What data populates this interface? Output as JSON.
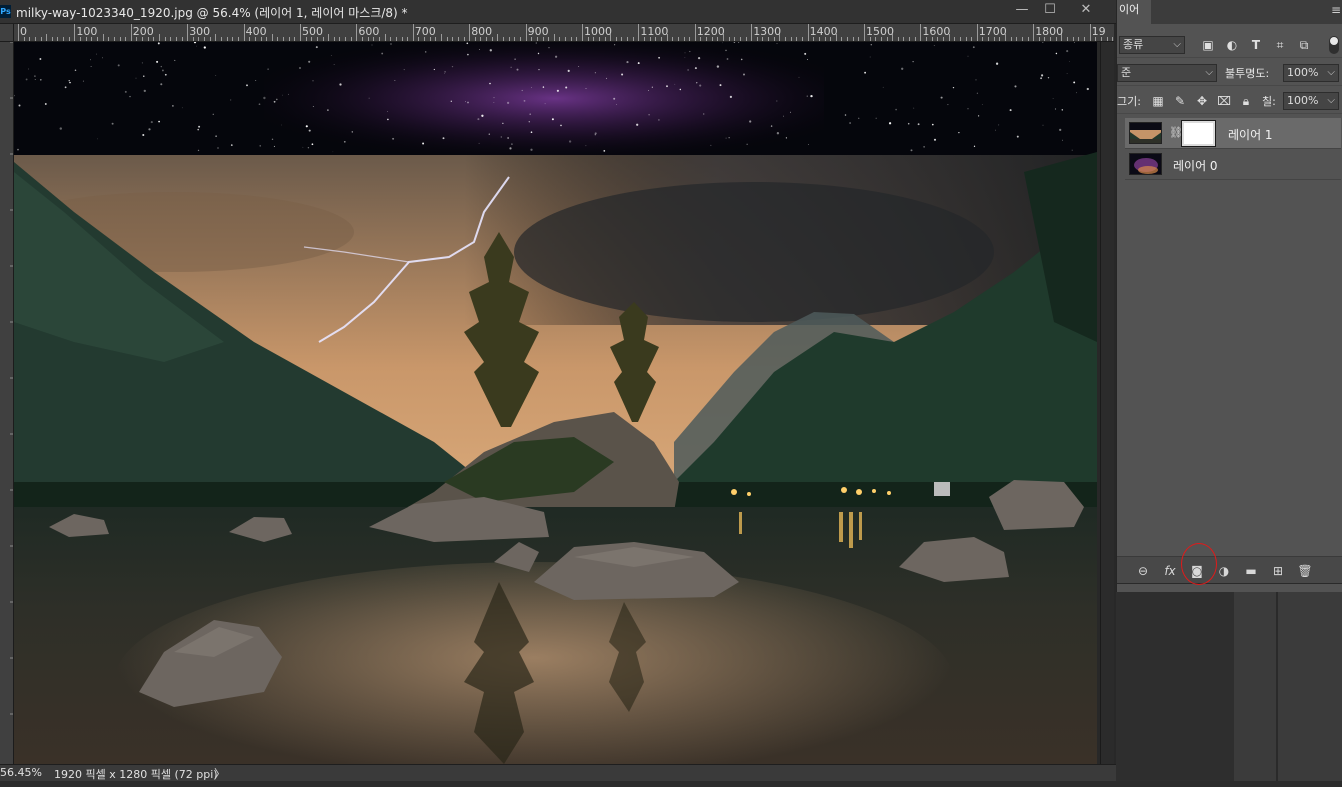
{
  "window": {
    "app_badge": "Ps",
    "title": "milky-way-1023340_1920.jpg @ 56.4% (레이어 1, 레이어 마스크/8) *",
    "controls": {
      "minimize": "—",
      "restore": "☐",
      "close": "✕"
    }
  },
  "ruler": {
    "labels": [
      "0",
      "100",
      "200",
      "300",
      "400",
      "500",
      "600",
      "700",
      "800",
      "900",
      "1000",
      "1100",
      "1200",
      "1300",
      "1400",
      "1500",
      "1600",
      "1700",
      "1800",
      "19"
    ]
  },
  "status": {
    "zoom": "56.45%",
    "doc_info": "1920 픽셀 x 1280 픽셀 (72 ppi)",
    "arrow": "〉"
  },
  "layers_panel": {
    "tab_label": "이어",
    "menu_icon": "≡",
    "filter": {
      "kind_label": "종류",
      "icons": [
        "image-filter",
        "adjustment-filter",
        "type-filter",
        "shape-filter",
        "smart-object-filter"
      ]
    },
    "blend_mode": "준",
    "opacity_label": "불투명도:",
    "opacity_value": "100%",
    "lock_label": "그기:",
    "fill_label": "칠:",
    "fill_value": "100%",
    "layers": [
      {
        "name": "레이어 1",
        "selected": true,
        "has_mask": true
      },
      {
        "name": "레이어 0",
        "selected": false,
        "has_mask": false
      }
    ],
    "footer_icons": [
      "link",
      "fx",
      "add-mask",
      "adjustment",
      "group",
      "new-layer",
      "delete"
    ],
    "highlight_color": "#e01a1a"
  }
}
